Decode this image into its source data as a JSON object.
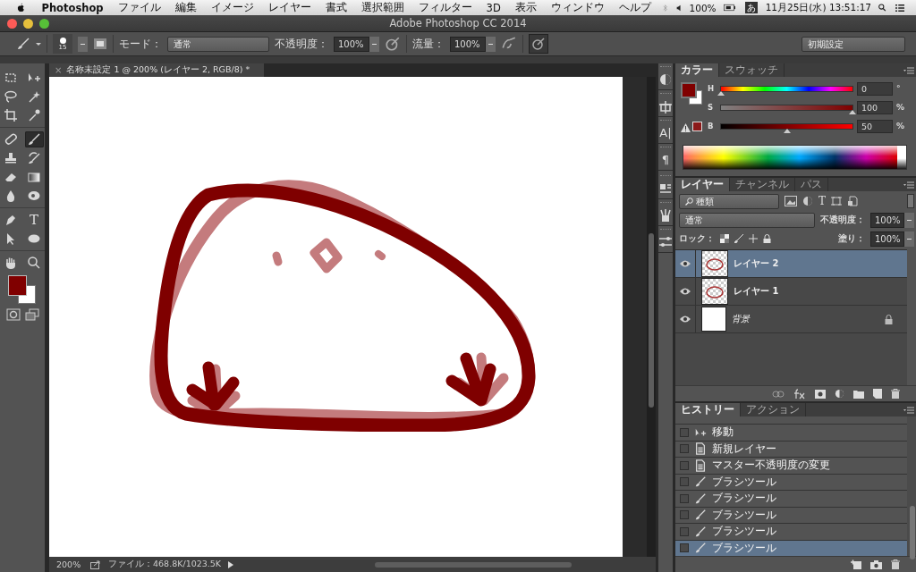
{
  "menubar": {
    "app_name": "Photoshop",
    "items": [
      "ファイル",
      "編集",
      "イメージ",
      "レイヤー",
      "書式",
      "選択範囲",
      "フィルター",
      "3D",
      "表示",
      "ウィンドウ",
      "ヘルプ"
    ],
    "battery": "100%",
    "input_method": "あ",
    "clock": "11月25日(水) 13:51:17"
  },
  "window": {
    "title": "Adobe Photoshop CC 2014"
  },
  "options_bar": {
    "brush_size": "15",
    "mode_label": "モード：",
    "mode": "通常",
    "opacity_label": "不透明度：",
    "opacity": "100%",
    "flow_label": "流量：",
    "flow": "100%",
    "workspace": "初期設定"
  },
  "tools": {
    "items": [
      {
        "kind": "marquee",
        "selected": false
      },
      {
        "kind": "move",
        "selected": false
      },
      {
        "kind": "lasso",
        "selected": false
      },
      {
        "kind": "wand",
        "selected": false
      },
      {
        "kind": "crop",
        "selected": false
      },
      {
        "kind": "eyedropper",
        "selected": false
      },
      {
        "kind": "healing",
        "selected": false
      },
      {
        "kind": "brush",
        "selected": true
      },
      {
        "kind": "stamp",
        "selected": false
      },
      {
        "kind": "history-brush",
        "selected": false
      },
      {
        "kind": "eraser",
        "selected": false
      },
      {
        "kind": "gradient",
        "selected": false
      },
      {
        "kind": "blur",
        "selected": false
      },
      {
        "kind": "dodge",
        "selected": false
      },
      {
        "kind": "pen",
        "selected": false
      },
      {
        "kind": "type",
        "glyph": "T",
        "selected": false
      },
      {
        "kind": "path-select",
        "selected": false
      },
      {
        "kind": "ellipse",
        "selected": false
      },
      {
        "kind": "hand",
        "selected": false
      },
      {
        "kind": "zoom",
        "selected": false
      }
    ]
  },
  "document": {
    "tab_close": "×",
    "tab_title": "名称未設定 1 @ 200% (レイヤー 2, RGB/8) *",
    "zoom": "200%",
    "file_info": "ファイル：468.8K/1023.5K"
  },
  "dock": [
    {
      "kind": "color"
    },
    {
      "kind": "transform"
    },
    {
      "kind": "character",
      "glyph": "A|"
    },
    {
      "kind": "paragraph",
      "glyph": "¶"
    },
    {
      "kind": "styles"
    },
    {
      "kind": "brush-presets"
    },
    {
      "kind": "adjust"
    }
  ],
  "color_panel": {
    "tabs": [
      {
        "label": "カラー",
        "selected": true
      },
      {
        "label": "スウォッチ",
        "selected": false
      }
    ],
    "sliders": [
      {
        "kind": "hue",
        "label": "H",
        "level": 0,
        "value": "0",
        "unit": "°"
      },
      {
        "kind": "saturation",
        "label": "S",
        "level": 1,
        "value": "100",
        "unit": "%"
      },
      {
        "kind": "brightness",
        "label": "B",
        "level": 0.5,
        "value": "50",
        "unit": "%"
      }
    ]
  },
  "layers_panel": {
    "tabs": [
      {
        "label": "レイヤー",
        "selected": true
      },
      {
        "label": "チャンネル",
        "selected": false
      },
      {
        "label": "パス",
        "selected": false
      }
    ],
    "filter": "種類",
    "type_glyph": "T",
    "blend_mode": "通常",
    "opacity_label": "不透明度：",
    "opacity": "100%",
    "lock_label": "ロック：",
    "fill_label": "塗り：",
    "fill": "100%",
    "layers": [
      {
        "name": "レイヤー 2",
        "kind": "drawing",
        "visible": true,
        "locked": false,
        "selected": true
      },
      {
        "name": "レイヤー 1",
        "kind": "drawing",
        "visible": true,
        "locked": false,
        "selected": false
      },
      {
        "name": "背景",
        "kind": "background",
        "visible": true,
        "locked": true,
        "selected": false
      }
    ]
  },
  "history_panel": {
    "tabs": [
      {
        "label": "ヒストリー",
        "selected": true
      },
      {
        "label": "アクション",
        "selected": false
      }
    ],
    "items": [
      {
        "kind": "move",
        "label": "移動",
        "selected": false
      },
      {
        "kind": "document",
        "label": "新規レイヤー",
        "selected": false
      },
      {
        "kind": "document",
        "label": "マスター不透明度の変更",
        "selected": false
      },
      {
        "kind": "brush",
        "label": "ブラシツール",
        "selected": false
      },
      {
        "kind": "brush",
        "label": "ブラシツール",
        "selected": false
      },
      {
        "kind": "brush",
        "label": "ブラシツール",
        "selected": false
      },
      {
        "kind": "brush",
        "label": "ブラシツール",
        "selected": false
      },
      {
        "kind": "brush",
        "label": "ブラシツール",
        "selected": true
      }
    ]
  }
}
